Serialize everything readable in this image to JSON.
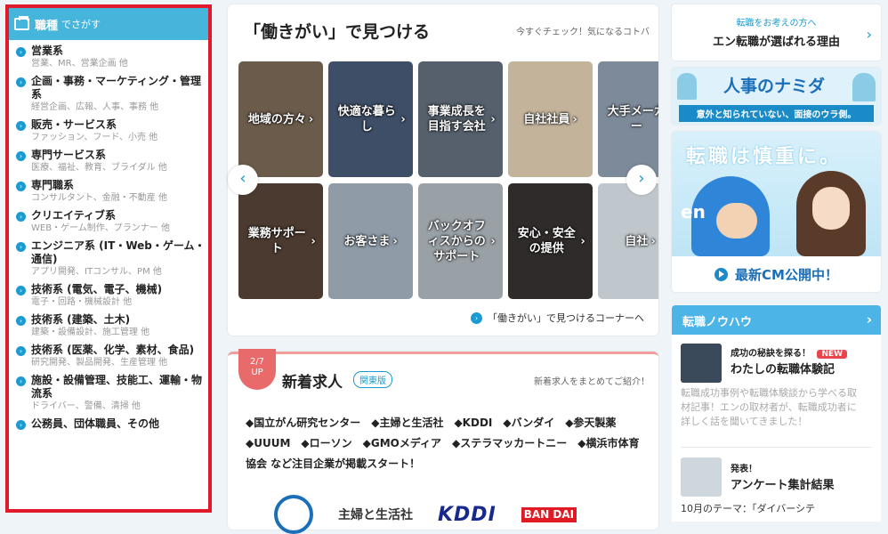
{
  "left": {
    "title": "職種",
    "title_suffix": "でさがす",
    "categories": [
      {
        "title": "営業系",
        "sub": "営業、MR、営業企画 他"
      },
      {
        "title": "企画・事務・マーケティング・管理系",
        "sub": "経営企画、広報、人事、事務 他"
      },
      {
        "title": "販売・サービス系",
        "sub": "ファッション、フード、小売 他"
      },
      {
        "title": "専門サービス系",
        "sub": "医療、福祉、教育、ブライダル 他"
      },
      {
        "title": "専門職系",
        "sub": "コンサルタント、金融・不動産 他"
      },
      {
        "title": "クリエイティブ系",
        "sub": "WEB・ゲーム制作、プランナー 他"
      },
      {
        "title": "エンジニア系 (IT・Web・ゲーム・通信)",
        "sub": "アプリ開発、ITコンサル、PM 他"
      },
      {
        "title": "技術系 (電気、電子、機械)",
        "sub": "電子・回路・機械設計 他"
      },
      {
        "title": "技術系 (建築、土木)",
        "sub": "建築・設備設計、施工管理 他"
      },
      {
        "title": "技術系 (医薬、化学、素材、食品)",
        "sub": "研究開発、製品開発、生産管理 他"
      },
      {
        "title": "施設・設備管理、技能工、運輸・物流系",
        "sub": "ドライバー、警備、清掃 他"
      },
      {
        "title": "公務員、団体職員、その他",
        "sub": ""
      }
    ]
  },
  "hataraki": {
    "title": "「働きがい」で見つける",
    "check": "今すぐチェック！気になるコトバ",
    "tiles_row1": [
      "地域の方々",
      "快適な暮らし",
      "事業成長を目指す会社",
      "自社社員",
      "大手メーカー"
    ],
    "tiles_row2": [
      "業務サポート",
      "お客さま",
      "バックオフィスからのサポート",
      "安心・安全の提供",
      "自社"
    ],
    "corner_link": "「働きがい」で見つけるコーナーへ",
    "prev": "‹",
    "next": "›"
  },
  "shinchaku": {
    "badge_date": "2/7",
    "badge_up": "UP",
    "title": "新着求人",
    "region": "関東版",
    "summary": "新着求人をまとめてご紹介！",
    "companies_text": "◆国立がん研究センター　◆主婦と生活社　◆KDDI　◆バンダイ　◆参天製薬　◆UUUM　◆ローソン　◆GMOメディア　◆ステラマッカートニー　◆横浜市体育協会 など注目企業が掲載スタート！",
    "logo_shufu": "主婦と生活社",
    "logo_kddi": "KDDI",
    "logo_bandai": "BAN DAI"
  },
  "right": {
    "reason_small": "転職をお考えの方へ",
    "reason_big": "エン転職が選ばれる理由",
    "namida_title": "人事のナミダ",
    "namida_sub": "意外と知られていない、面接のウラ側。",
    "cm_slogan": "転職は慎重に。",
    "cm_en": "en",
    "cm_cta": "最新CM公開中！",
    "knowhow_title": "転職ノウハウ",
    "item1_pre": "成功の秘訣を探る！",
    "item1_new": "NEW",
    "item1_title": "わたしの転職体験記",
    "item1_desc": "転職成功事例や転職体験談から学べる取材記事！エンの取材者が、転職成功者に詳しく話を聞いてきました！",
    "item2_pre": "発表！",
    "item2_title": "アンケート集計結果",
    "item2_desc": "10月のテーマ：「ダイバーシテ"
  },
  "colors": {
    "accent": "#1b9bd0",
    "highlight_border": "#e0192b",
    "new_badge": "#e9454d"
  }
}
